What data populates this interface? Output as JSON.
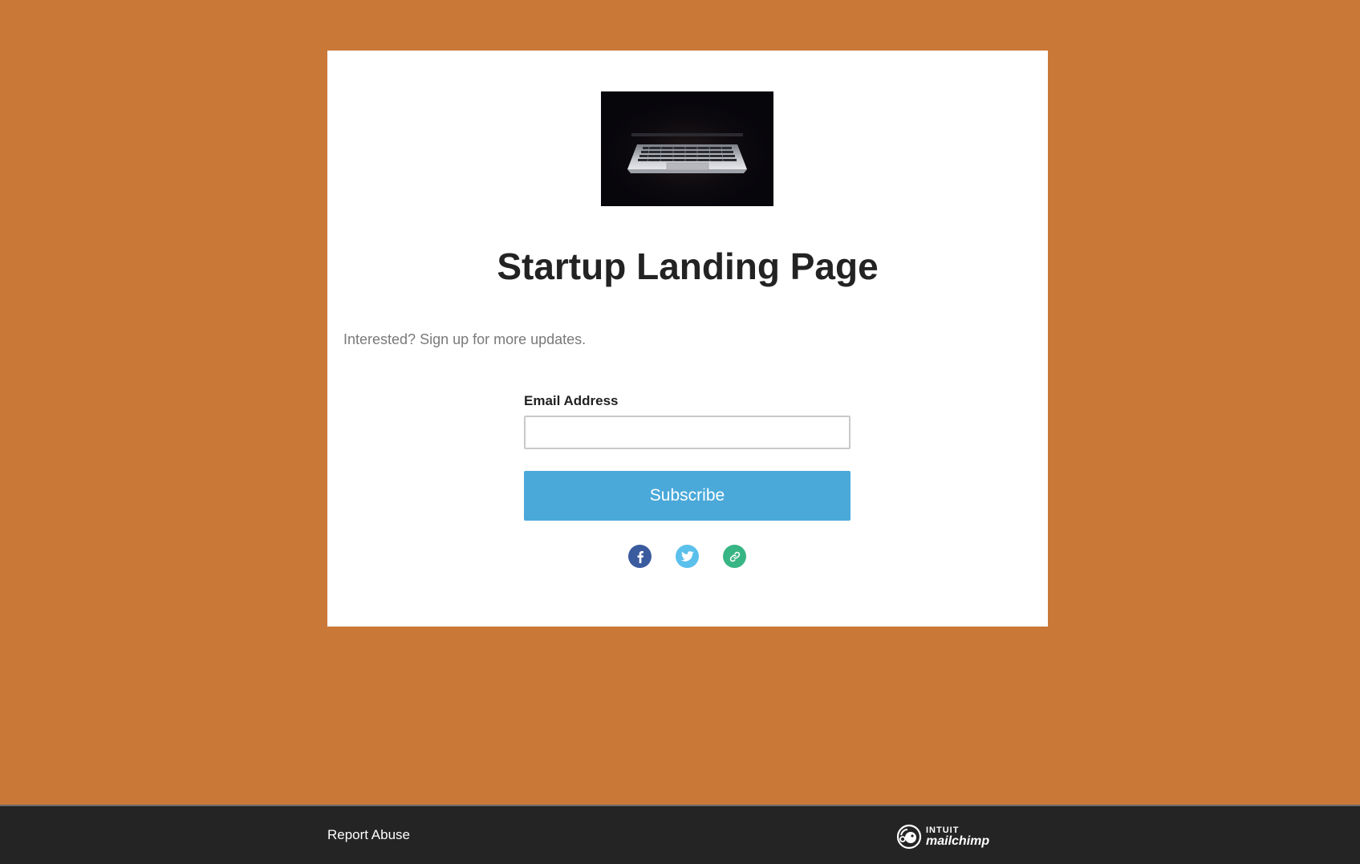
{
  "page": {
    "background_color": "#ca7838",
    "title": "Startup Landing Page",
    "subtitle": "Interested? Sign up for more updates.",
    "hero_image": "laptop-in-dark-image"
  },
  "form": {
    "email_label": "Email Address",
    "email_value": "",
    "email_placeholder": "",
    "subscribe_label": "Subscribe",
    "button_color": "#4aa9d9"
  },
  "social": {
    "facebook": {
      "icon": "facebook-icon",
      "color": "#3b5b9f"
    },
    "twitter": {
      "icon": "twitter-icon",
      "color": "#5bc0eb"
    },
    "link": {
      "icon": "link-icon",
      "color": "#38b584"
    }
  },
  "footer": {
    "report_label": "Report Abuse",
    "logo_brand": "INTUIT",
    "logo_product": "mailchimp"
  }
}
